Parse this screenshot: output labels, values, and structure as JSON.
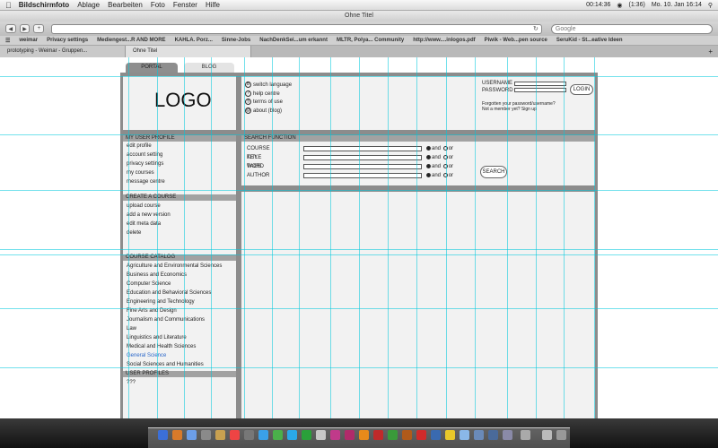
{
  "menubar": {
    "app": "Bildschirmfoto",
    "menus": [
      "Ablage",
      "Bearbeiten",
      "Foto",
      "Fenster",
      "Hilfe"
    ],
    "clock": "00:14:36",
    "battery": "(1:36)",
    "date": "Mo. 10. Jan 16:14"
  },
  "window": {
    "title": "Ohne Titel"
  },
  "toolbar": {
    "search_placeholder": "Google"
  },
  "bookmarks": [
    "weimar",
    "Privacy settings",
    "Mediengest...R AND MORE",
    "KAHLA. Porz...",
    "Sinne-Jobs",
    "NachDenkSei...um erkannt",
    "MLTR, Polya... Community",
    "http://www....inlogos.pdf",
    "Piwik - Web...pen source",
    "SeruKid - St...eative Ideen"
  ],
  "browser_tabs": [
    "prototyping - Weimar - Gruppen...",
    "Ohne Titel"
  ],
  "nav": {
    "portal": "PORTAL",
    "blog": "BLOG"
  },
  "header": {
    "logo": "LOGO",
    "links": [
      {
        "icon": "B",
        "label": "switch language"
      },
      {
        "icon": "?",
        "label": "help centre"
      },
      {
        "icon": "§",
        "label": "terms of use"
      },
      {
        "icon": "@",
        "label": "about (blog)"
      }
    ],
    "login": {
      "username_label": "USERNAME",
      "password_label": "PASSWORD",
      "button": "LOGIN",
      "forgot": "Forgotten your password/username?",
      "signup": "Not a member yet? Sign up"
    }
  },
  "profile": {
    "title": "MY USER PROFILE",
    "items": [
      "edit profile",
      "account setting",
      "privacy settings",
      "my courses",
      "message centre"
    ]
  },
  "create": {
    "title": "CREATE A COURSE",
    "items": [
      "upload course",
      "add a new version",
      "edit meta data",
      "delete"
    ]
  },
  "catalog": {
    "title": "COURSE CATALOG",
    "items": [
      "Agriculture and Environmental Sciences",
      "Business and Economics",
      "Computer Science",
      "Education and Behavioral Sciences",
      "Engineering and Technology",
      "Fine Arts and Design",
      "Journalism and Communications",
      "Law",
      "Linguistics and Literature",
      "Medical and Health Sciences",
      "General Science",
      "Social Sciences and Humanities"
    ],
    "highlighted": "General Science"
  },
  "user_profiles": {
    "title": "USER PROFILES",
    "text": "???"
  },
  "search": {
    "title": "SEARCH FUNCTION",
    "rows": [
      "COURSE TITLE",
      "KEY WORD",
      "TAGS",
      "AUTHOR"
    ],
    "and_label": "and",
    "or_label": "or",
    "button": "SEARCH"
  }
}
